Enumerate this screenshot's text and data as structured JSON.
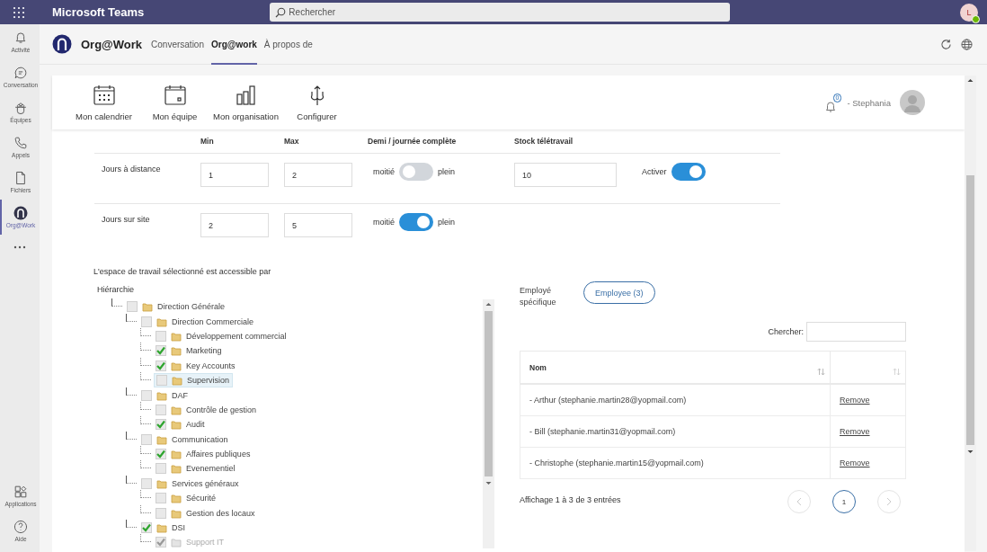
{
  "app_bar": {
    "title": "Microsoft Teams",
    "search": {
      "placeholder": "Rechercher"
    },
    "avatar": "L"
  },
  "rail": [
    {
      "label": "Activité",
      "selected": false
    },
    {
      "label": "Conversation",
      "selected": false
    },
    {
      "label": "Équipes",
      "selected": false
    },
    {
      "label": "Appels",
      "selected": false
    },
    {
      "label": "Fichiers",
      "selected": false
    },
    {
      "label": "Org@Work",
      "selected": true
    }
  ],
  "rail_bottom": [
    {
      "label": "Applications"
    },
    {
      "label": "Aide"
    }
  ],
  "app_header": {
    "name": "Org@Work",
    "tabs": [
      {
        "label": "Conversation",
        "selected": false
      },
      {
        "label": "Org@work",
        "selected": true
      },
      {
        "label": "À propos de",
        "selected": false
      }
    ]
  },
  "toolbar": {
    "items": [
      {
        "label": "Mon calendrier"
      },
      {
        "label": "Mon équipe"
      },
      {
        "label": "Mon organisation"
      },
      {
        "label": "Configurer"
      }
    ],
    "notifications": "0",
    "user": "- Stephania"
  },
  "settings": {
    "columns": [
      "Min",
      "Max",
      "Demi / journée complète",
      "Stock télétravail"
    ],
    "rows": [
      {
        "label": "Jours à distance",
        "min": "1",
        "max": "2",
        "half_label": "moitié",
        "full_label": "plein",
        "full_day": false,
        "stock": "10",
        "activate": {
          "label": "Activer",
          "on": true
        }
      },
      {
        "label": "Jours sur site",
        "min": "2",
        "max": "5",
        "half_label": "moitié",
        "full_label": "plein",
        "full_day": true
      }
    ]
  },
  "access": {
    "caption": "L'espace de travail sélectionné est accessible par",
    "hierarchy_label": "Hiérarchie",
    "tree": [
      {
        "label": "Direction Générale",
        "checked": false,
        "selected": false,
        "disabled": false,
        "children": [
          {
            "label": "Direction Commerciale",
            "checked": false,
            "selected": false,
            "disabled": false,
            "children": [
              {
                "label": "Développement commercial",
                "checked": false,
                "selected": false,
                "disabled": false
              },
              {
                "label": "Marketing",
                "checked": true,
                "selected": false,
                "disabled": false
              },
              {
                "label": "Key Accounts",
                "checked": true,
                "selected": false,
                "disabled": false
              },
              {
                "label": "Supervision",
                "checked": false,
                "selected": true,
                "disabled": false
              }
            ]
          },
          {
            "label": "DAF",
            "checked": false,
            "selected": false,
            "disabled": false,
            "children": [
              {
                "label": "Contrôle de gestion",
                "checked": false,
                "selected": false,
                "disabled": false
              },
              {
                "label": "Audit",
                "checked": true,
                "selected": false,
                "disabled": false
              }
            ]
          },
          {
            "label": "Communication",
            "checked": false,
            "selected": false,
            "disabled": false,
            "children": [
              {
                "label": "Affaires publiques",
                "checked": true,
                "selected": false,
                "disabled": false
              },
              {
                "label": "Evenementiel",
                "checked": false,
                "selected": false,
                "disabled": false
              }
            ]
          },
          {
            "label": "Services généraux",
            "checked": false,
            "selected": false,
            "disabled": false,
            "children": [
              {
                "label": "Sécurité",
                "checked": false,
                "selected": false,
                "disabled": false
              },
              {
                "label": "Gestion des locaux",
                "checked": false,
                "selected": false,
                "disabled": false
              }
            ]
          },
          {
            "label": "DSI",
            "checked": true,
            "selected": false,
            "disabled": false,
            "children": [
              {
                "label": "Support IT",
                "checked": true,
                "selected": false,
                "disabled": true
              }
            ]
          }
        ]
      }
    ]
  },
  "employees": {
    "label": "Employé spécifique",
    "button": "Employee (3)",
    "search_label": "Chercher:",
    "columns": [
      "Nom"
    ],
    "rows": [
      {
        "name": "- Arthur (stephanie.martin28@yopmail.com)",
        "action": "Remove"
      },
      {
        "name": "- Bill (stephanie.martin31@yopmail.com)",
        "action": "Remove"
      },
      {
        "name": "- Christophe (stephanie.martin15@yopmail.com)",
        "action": "Remove"
      }
    ],
    "info": "Affichage 1 à 3 de 3 entrées",
    "pages": [
      {
        "label": "1",
        "selected": true
      }
    ]
  }
}
